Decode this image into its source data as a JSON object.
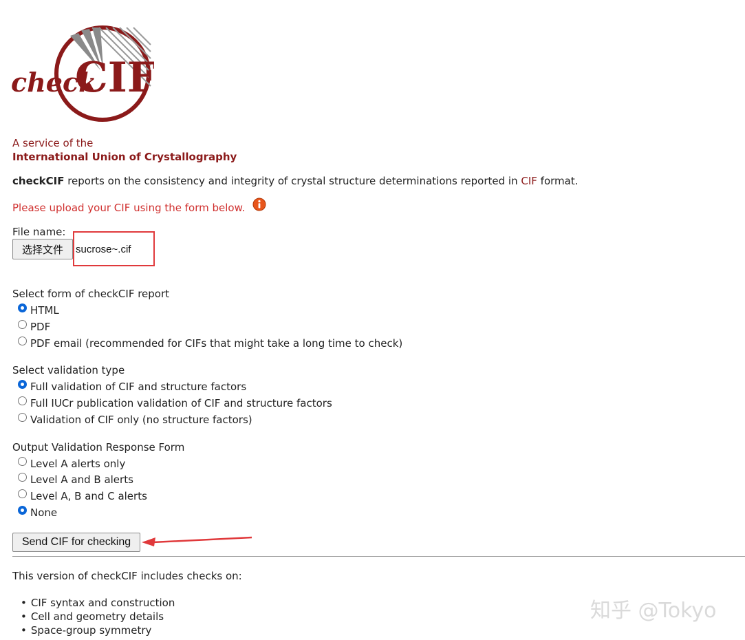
{
  "logo": {
    "text_check": "check",
    "text_cif": "CIF"
  },
  "service": {
    "line1": "A service of the",
    "line2": "International Union of Crystallography"
  },
  "intro": {
    "prefix": "checkCIF",
    "middle": " reports on the consistency and integrity of crystal structure determinations reported in ",
    "link": "CIF",
    "suffix": " format."
  },
  "upload_prompt": "Please upload your CIF using the form below.",
  "file": {
    "label": "File name:",
    "button_label": "选择文件",
    "value": "sucrose~.cif"
  },
  "report_form": {
    "title": "Select form of checkCIF report",
    "options": [
      {
        "label": "HTML",
        "checked": true
      },
      {
        "label": "PDF",
        "checked": false
      },
      {
        "label": "PDF email (recommended for CIFs that might take a long time to check)",
        "checked": false
      }
    ]
  },
  "validation_type": {
    "title": "Select validation type",
    "options": [
      {
        "label": "Full validation of CIF and structure factors",
        "checked": true
      },
      {
        "label": "Full IUCr publication validation of CIF and structure factors",
        "checked": false
      },
      {
        "label": "Validation of CIF only (no structure factors)",
        "checked": false
      }
    ]
  },
  "response_form": {
    "title": "Output Validation Response Form",
    "options": [
      {
        "label": "Level A alerts only",
        "checked": false
      },
      {
        "label": "Level A and B alerts",
        "checked": false
      },
      {
        "label": "Level A, B and C alerts",
        "checked": false
      },
      {
        "label": "None",
        "checked": true
      }
    ]
  },
  "submit_label": "Send CIF for checking",
  "checks": {
    "title": "This version of checkCIF includes checks on:",
    "items": [
      "CIF syntax and construction",
      "Cell and geometry details",
      "Space-group symmetry"
    ]
  },
  "watermark": "知乎 @Tokyo",
  "colors": {
    "brand_red": "#8b1a1a",
    "prompt_red": "#d0302f",
    "annotation_red": "#e0393b",
    "radio_blue": "#0a66d8"
  }
}
